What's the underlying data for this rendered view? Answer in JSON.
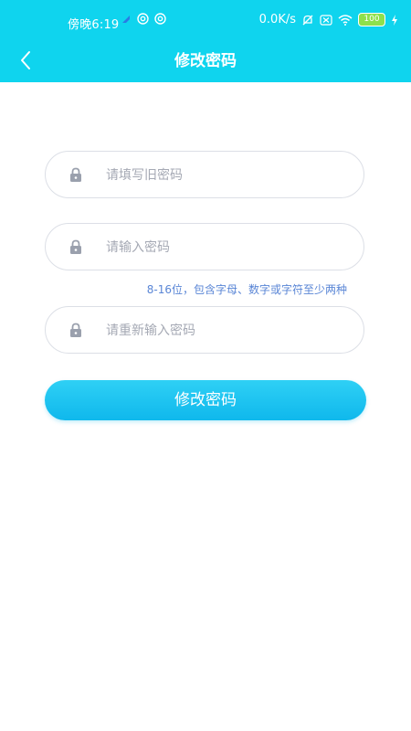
{
  "status_bar": {
    "time": "傍晚6:19",
    "net_speed": "0.0K/s",
    "battery": "100"
  },
  "nav": {
    "title": "修改密码"
  },
  "form": {
    "old_password": {
      "placeholder": "请填写旧密码",
      "value": ""
    },
    "new_password": {
      "placeholder": "请输入密码",
      "value": ""
    },
    "confirm_password": {
      "placeholder": "请重新输入密码",
      "value": ""
    },
    "hint": "8-16位，包含字母、数字或字符至少两种",
    "submit_label": "修改密码"
  },
  "colors": {
    "header_bg": "#0fd4ee",
    "hint_text": "#5a86d6",
    "button_bg": "#18c2f0"
  },
  "icons": {
    "back": "chevron-left-icon",
    "lock": "lock-icon"
  }
}
